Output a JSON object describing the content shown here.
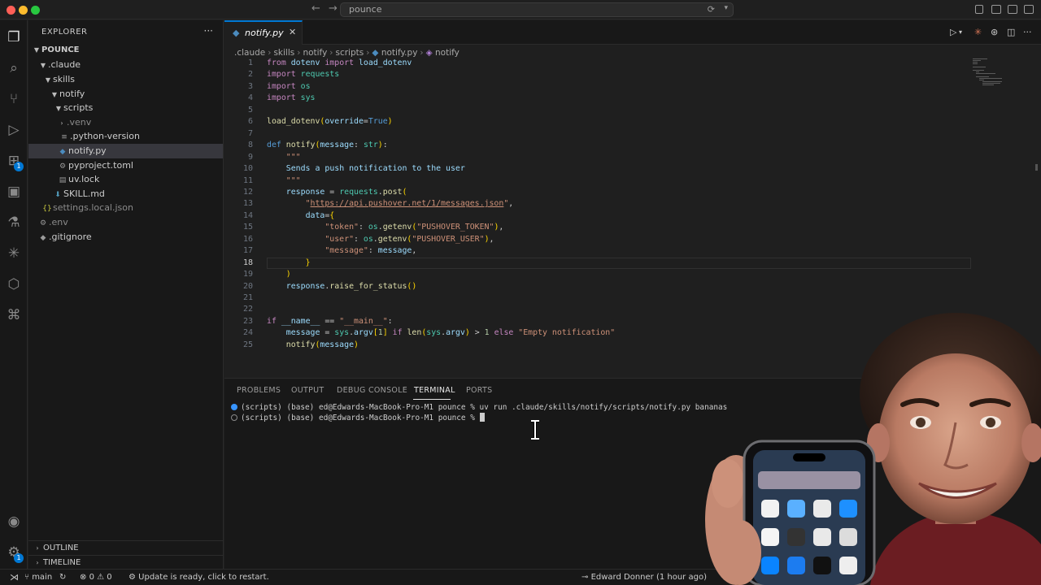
{
  "window": {
    "search_text": "pounce"
  },
  "explorer": {
    "title": "EXPLORER",
    "more_icon": "ellipsis-icon",
    "root": "POUNCE",
    "items": [
      {
        "label": ".claude",
        "type": "folder",
        "open": true
      },
      {
        "label": "skills",
        "type": "folder",
        "open": true
      },
      {
        "label": "notify",
        "type": "folder",
        "open": true
      },
      {
        "label": "scripts",
        "type": "folder",
        "open": true
      },
      {
        "label": ".venv",
        "type": "folder",
        "open": false
      },
      {
        "label": ".python-version",
        "type": "file"
      },
      {
        "label": "notify.py",
        "type": "file",
        "selected": true
      },
      {
        "label": "pyproject.toml",
        "type": "file"
      },
      {
        "label": "uv.lock",
        "type": "file"
      },
      {
        "label": "SKILL.md",
        "type": "file"
      },
      {
        "label": "settings.local.json",
        "type": "file"
      },
      {
        "label": ".env",
        "type": "file"
      },
      {
        "label": ".gitignore",
        "type": "file"
      }
    ],
    "outline_label": "OUTLINE",
    "timeline_label": "TIMELINE"
  },
  "activity_bar": {
    "icons": [
      "files-icon",
      "search-icon",
      "source-control-icon",
      "run-debug-icon",
      "extensions-icon",
      "remote-explorer-icon",
      "testing-icon",
      "claude-icon",
      "containers-icon",
      "python-icon",
      "accounts-icon",
      "settings-gear-icon"
    ],
    "extensions_badge": "1",
    "settings_badge": "1"
  },
  "editor": {
    "tab_label": "notify.py",
    "breadcrumb": [
      ".claude",
      "skills",
      "notify",
      "scripts",
      "notify.py",
      "notify"
    ],
    "current_line": 18,
    "line_numbers": [
      "1",
      "2",
      "3",
      "4",
      "5",
      "6",
      "7",
      "8",
      "9",
      "10",
      "11",
      "12",
      "13",
      "14",
      "15",
      "16",
      "17",
      "18",
      "19",
      "20",
      "21",
      "22",
      "23",
      "24",
      "25"
    ],
    "code_lines": [
      "from dotenv import load_dotenv",
      "import requests",
      "import os",
      "import sys",
      "",
      "load_dotenv(override=True)",
      "",
      "def notify(message: str):",
      "    \"\"\"",
      "    Sends a push notification to the user",
      "    \"\"\"",
      "    response = requests.post(",
      "        \"https://api.pushover.net/1/messages.json\",",
      "        data={",
      "            \"token\": os.getenv(\"PUSHOVER_TOKEN\"),",
      "            \"user\": os.getenv(\"PUSHOVER_USER\"),",
      "            \"message\": message,",
      "        }",
      "    )",
      "    response.raise_for_status()",
      "",
      "",
      "if __name__ == \"__main__\":",
      "    message = sys.argv[1] if len(sys.argv) > 1 else \"Empty notification\"",
      "    notify(message)"
    ]
  },
  "panel": {
    "tabs": [
      "PROBLEMS",
      "OUTPUT",
      "DEBUG CONSOLE",
      "TERMINAL",
      "PORTS"
    ],
    "active_tab": "TERMINAL",
    "terminal_lines": [
      "(scripts) (base) ed@Edwards-MacBook-Pro-M1 pounce % uv run .claude/skills/notify/scripts/notify.py bananas",
      "(scripts) (base) ed@Edwards-MacBook-Pro-M1 pounce % "
    ]
  },
  "status_bar": {
    "branch": "main",
    "errors": "0",
    "warnings": "0",
    "update_message": "Update is ready, click to restart.",
    "blame": "Edward Donner (1 hour ago)"
  },
  "colors": {
    "accent": "#0078d4",
    "background": "#1f1f1f",
    "sidebar": "#181818"
  }
}
